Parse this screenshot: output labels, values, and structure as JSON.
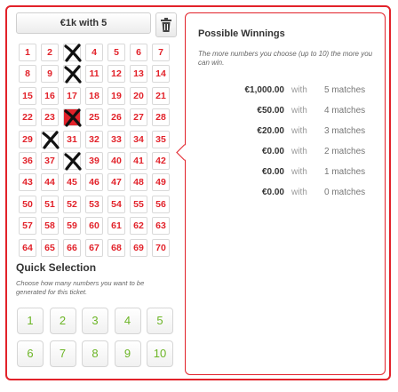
{
  "ticket": {
    "title": "€1k with 5"
  },
  "numbers": [
    1,
    2,
    3,
    4,
    5,
    6,
    7,
    8,
    9,
    10,
    11,
    12,
    13,
    14,
    15,
    16,
    17,
    18,
    19,
    20,
    21,
    22,
    23,
    24,
    25,
    26,
    27,
    28,
    29,
    30,
    31,
    32,
    33,
    34,
    35,
    36,
    37,
    38,
    39,
    40,
    41,
    42,
    43,
    44,
    45,
    46,
    47,
    48,
    49,
    50,
    51,
    52,
    53,
    54,
    55,
    56,
    57,
    58,
    59,
    60,
    61,
    62,
    63,
    64,
    65,
    66,
    67,
    68,
    69,
    70
  ],
  "marked_numbers": [
    3,
    10,
    24,
    30,
    38
  ],
  "quick_selection": {
    "title": "Quick Selection",
    "description": "Choose how many numbers you want to be generated for this ticket.",
    "buttons": [
      "1",
      "2",
      "3",
      "4",
      "5",
      "6",
      "7",
      "8",
      "9",
      "10"
    ]
  },
  "winnings": {
    "title": "Possible Winnings",
    "description": "The more numbers you choose (up to 10) the more you can win.",
    "with_label": "with",
    "rows": [
      {
        "amount": "€1,000.00",
        "matches": "5 matches"
      },
      {
        "amount": "€50.00",
        "matches": "4 matches"
      },
      {
        "amount": "€20.00",
        "matches": "3 matches"
      },
      {
        "amount": "€0.00",
        "matches": "2 matches"
      },
      {
        "amount": "€0.00",
        "matches": "1 matches"
      },
      {
        "amount": "€0.00",
        "matches": "0 matches"
      }
    ]
  },
  "colors": {
    "accent": "#e2222a",
    "quick_button_text": "#6cb526",
    "mark": "#111111"
  },
  "icons": {
    "clear": "trash-icon",
    "mark": "x-mark-icon"
  }
}
